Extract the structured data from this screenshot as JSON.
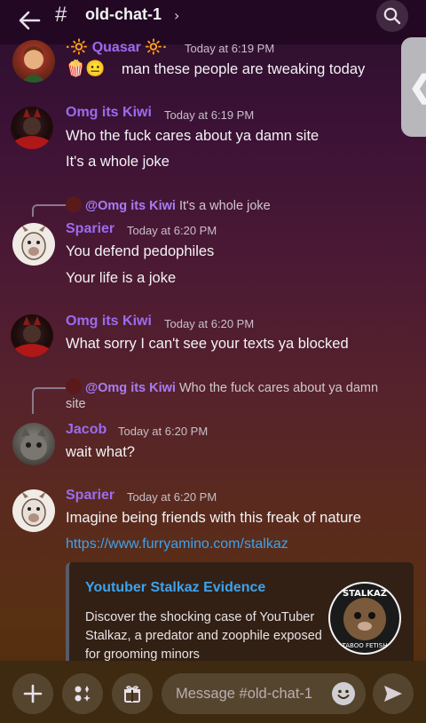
{
  "header": {
    "hash": "#",
    "channel_name": "old-chat-1",
    "chevron": "›",
    "back_icon": "arrow-left-icon",
    "search_icon": "search-icon"
  },
  "side_handle": {
    "glyph": "❮"
  },
  "messages": [
    {
      "author": "Quasar",
      "author_prefix": "·🔆",
      "author_suffix": "🔆·",
      "timestamp": "Today at 6:19 PM",
      "lines": [
        "man  these people are tweaking today"
      ],
      "emoji": "🍿😐"
    },
    {
      "author": "Omg its Kiwi",
      "timestamp": "Today at 6:19 PM",
      "lines": [
        "Who the fuck cares about ya damn site",
        "It's a whole joke"
      ]
    },
    {
      "reply": {
        "mention": "@Omg its Kiwi",
        "text": "It's a whole joke"
      },
      "author": "Sparier",
      "timestamp": "Today at 6:20 PM",
      "lines": [
        "You defend pedophiles",
        "Your life is a joke"
      ]
    },
    {
      "author": "Omg its Kiwi",
      "timestamp": "Today at 6:20 PM",
      "lines": [
        "What sorry I can't see your texts ya blocked"
      ]
    },
    {
      "reply": {
        "mention": "@Omg its Kiwi",
        "text": "Who the fuck cares about ya damn",
        "text2": "site"
      },
      "author": "Jacob",
      "timestamp": "Today at 6:20 PM",
      "lines": [
        "wait what?"
      ]
    },
    {
      "author": "Sparier",
      "timestamp": "Today at 6:20 PM",
      "lines": [
        "Imagine being friends with this freak of nature"
      ],
      "link": "https://www.furryamino.com/stalkaz",
      "embed": {
        "title": "Youtuber Stalkaz Evidence",
        "description": "Discover the shocking case of YouTuber Stalkaz, a predator and zoophile exposed for grooming minors",
        "thumb_top": "STALKAZ",
        "thumb_bottom": "TABOO FETISH"
      }
    }
  ],
  "composer": {
    "placeholder": "Message #old-chat-1",
    "add_icon": "plus-icon",
    "apps_icon": "apps-icon",
    "gift_icon": "gift-icon",
    "emoji_icon": "emoji-icon",
    "send_icon": "send-icon"
  }
}
